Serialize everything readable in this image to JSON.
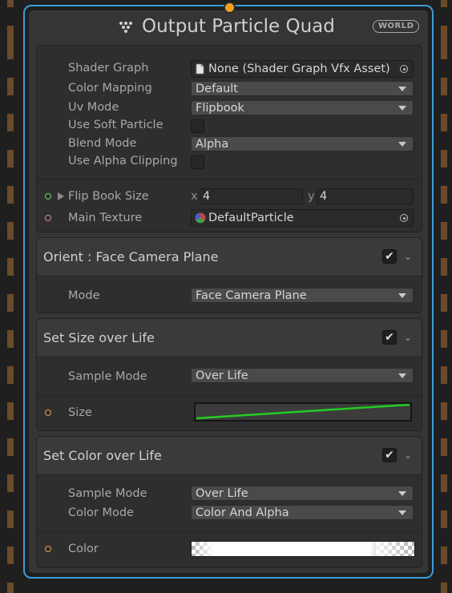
{
  "node": {
    "title": "Output Particle Quad",
    "space_badge": "WORLD",
    "icon": "output-dots-icon"
  },
  "main": {
    "shader_graph": {
      "label": "Shader Graph",
      "value": "None (Shader Graph Vfx Asset)",
      "icon": "file-icon"
    },
    "color_mapping": {
      "label": "Color Mapping",
      "value": "Default"
    },
    "uv_mode": {
      "label": "Uv Mode",
      "value": "Flipbook"
    },
    "use_soft_particle": {
      "label": "Use Soft Particle",
      "checked": false
    },
    "blend_mode": {
      "label": "Blend Mode",
      "value": "Alpha"
    },
    "use_alpha_clipping": {
      "label": "Use Alpha Clipping",
      "checked": false
    },
    "flip_book_size": {
      "label": "Flip Book Size",
      "x_label": "x",
      "x": "4",
      "y_label": "y",
      "y": "4"
    },
    "main_texture": {
      "label": "Main Texture",
      "value": "DefaultParticle",
      "icon": "texture-icon"
    }
  },
  "blocks": {
    "orient": {
      "title": "Orient : Face Camera Plane",
      "enabled": true,
      "mode": {
        "label": "Mode",
        "value": "Face Camera Plane"
      }
    },
    "size_over_life": {
      "title": "Set Size over Life",
      "enabled": true,
      "sample_mode": {
        "label": "Sample Mode",
        "value": "Over Life"
      },
      "size": {
        "label": "Size",
        "curve_color": "#22cc22"
      }
    },
    "color_over_life": {
      "title": "Set Color over Life",
      "enabled": true,
      "sample_mode": {
        "label": "Sample Mode",
        "value": "Over Life"
      },
      "color_mode": {
        "label": "Color Mode",
        "value": "Color And Alpha"
      },
      "color": {
        "label": "Color"
      }
    }
  },
  "colors": {
    "selection_outline": "#3c9bd8",
    "flow_port": "#f0a020",
    "float_port": "#6ad06a",
    "texture_port": "#e08585",
    "curve": "#22cc22"
  }
}
